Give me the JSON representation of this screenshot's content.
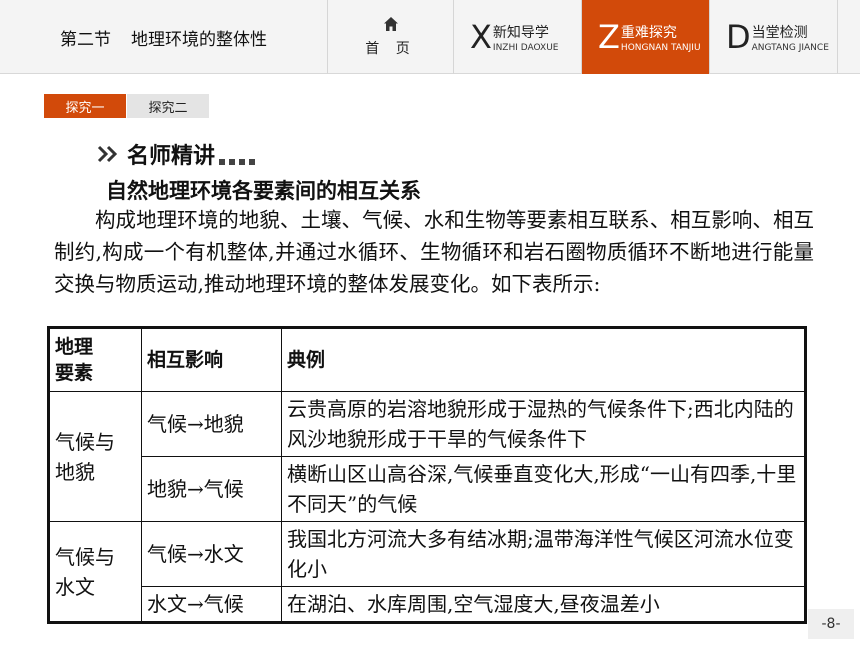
{
  "header": {
    "section_num": "第二节",
    "section_name": "地理环境的整体性",
    "home_label": "首 页",
    "tabs": [
      {
        "letter": "X",
        "cn": "新知导学",
        "pinyin": "INZHI DAOXUE",
        "active": false
      },
      {
        "letter": "Z",
        "cn": "重难探究",
        "pinyin": "HONGNAN TANJIU",
        "active": true
      },
      {
        "letter": "D",
        "cn": "当堂检测",
        "pinyin": "ANGTANG JIANCE",
        "active": false
      }
    ],
    "accent_color": "#d24a0a"
  },
  "subtabs": [
    {
      "label": "探究一",
      "active": true
    },
    {
      "label": "探究二",
      "active": false
    }
  ],
  "content": {
    "section_header": "名师精讲",
    "subtitle": "自然地理环境各要素间的相互关系",
    "paragraph": "构成地理环境的地貌、土壤、气候、水和生物等要素相互联系、相互影响、相互制约,构成一个有机整体,并通过水循环、生物循环和岩石圈物质循环不断地进行能量交换与物质运动,推动地理环境的整体发展变化。如下表所示:"
  },
  "table": {
    "headers": [
      "地理\n要素",
      "相互影响",
      "典例"
    ],
    "groups": [
      {
        "element": "气候与\n地貌",
        "rows": [
          {
            "influence": "气候→地貌",
            "example": "云贵高原的岩溶地貌形成于湿热的气候条件下;西北内陆的风沙地貌形成于干旱的气候条件下"
          },
          {
            "influence": "地貌→气候",
            "example": "横断山区山高谷深,气候垂直变化大,形成“一山有四季,十里不同天”的气候"
          }
        ]
      },
      {
        "element": "气候与\n水文",
        "rows": [
          {
            "influence": "气候→水文",
            "example": "我国北方河流大多有结冰期;温带海洋性气候区河流水位变化小"
          },
          {
            "influence": "水文→气候",
            "example": "在湖泊、水库周围,空气湿度大,昼夜温差小"
          }
        ]
      }
    ]
  },
  "page_number": "-8-"
}
